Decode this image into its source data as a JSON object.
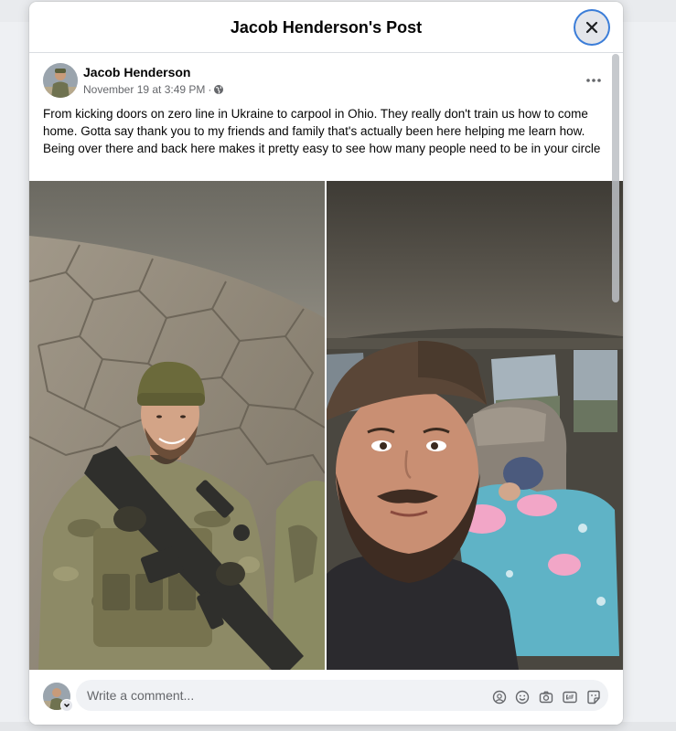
{
  "modal": {
    "title": "Jacob Henderson's Post"
  },
  "post": {
    "author": "Jacob Henderson",
    "timestamp": "November 19 at 3:49 PM",
    "meta_separator": "·",
    "audience_icon": "globe-icon",
    "text": "From kicking doors on zero line in Ukraine to carpool in Ohio. They really don't train us how to come home. Gotta say thank you to my friends and family that's actually been here helping me learn how. Being over there and back here makes it pretty easy to see how many people need to be in your circle",
    "more_icon": "more-options-icon",
    "photos": [
      {
        "subject": "soldier-in-gear-photo"
      },
      {
        "subject": "selfie-in-car-photo"
      }
    ]
  },
  "comment": {
    "placeholder": "Write a comment...",
    "icons": [
      "avatar-sticker-icon",
      "emoji-icon",
      "camera-icon",
      "gif-icon",
      "sticker-icon"
    ]
  },
  "colors": {
    "accent_focus": "#3b7dd8",
    "text_primary": "#050505",
    "text_secondary": "#65676b",
    "input_bg": "#f0f2f5"
  }
}
